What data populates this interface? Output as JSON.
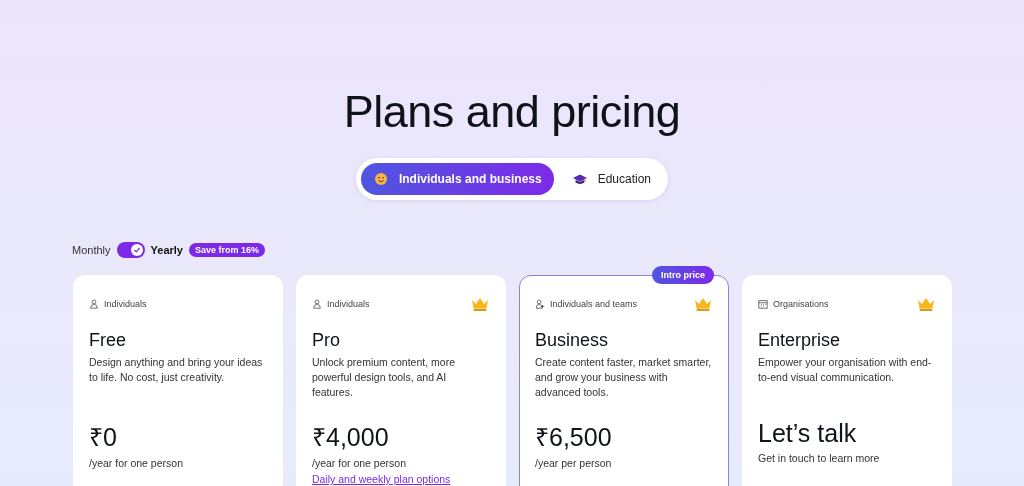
{
  "title": "Plans and pricing",
  "tabs": [
    {
      "label": "Individuals and business",
      "selected": true
    },
    {
      "label": "Education",
      "selected": false
    }
  ],
  "billing": {
    "left_label": "Monthly",
    "right_label": "Yearly",
    "on": true,
    "badge": "Save from 16%"
  },
  "plans": [
    {
      "audience": "Individuals",
      "kind": "person",
      "premium": false,
      "highlighted": false,
      "name": "Free",
      "description": "Design anything and bring your ideas to life. No cost, just creativity.",
      "price": "₹0",
      "price_note": "/year for one person"
    },
    {
      "audience": "Individuals",
      "kind": "person",
      "premium": true,
      "highlighted": false,
      "name": "Pro",
      "description": "Unlock premium content, more powerful design tools, and AI features.",
      "price": "₹4,000",
      "price_note": "/year for one person",
      "link": "Daily and weekly plan options"
    },
    {
      "audience": "Individuals and teams",
      "kind": "team",
      "premium": true,
      "highlighted": true,
      "badge": "Intro price",
      "name": "Business",
      "description": "Create content faster, market smarter, and grow your business with advanced tools.",
      "price": "₹6,500",
      "price_note": "/year per person"
    },
    {
      "audience": "Organisations",
      "kind": "organisation",
      "premium": true,
      "highlighted": false,
      "name": "Enterprise",
      "description": "Empower your organisation with end-to-end visual communication.",
      "price": "Let’s talk",
      "price_note": "Get in touch to learn more"
    }
  ]
}
